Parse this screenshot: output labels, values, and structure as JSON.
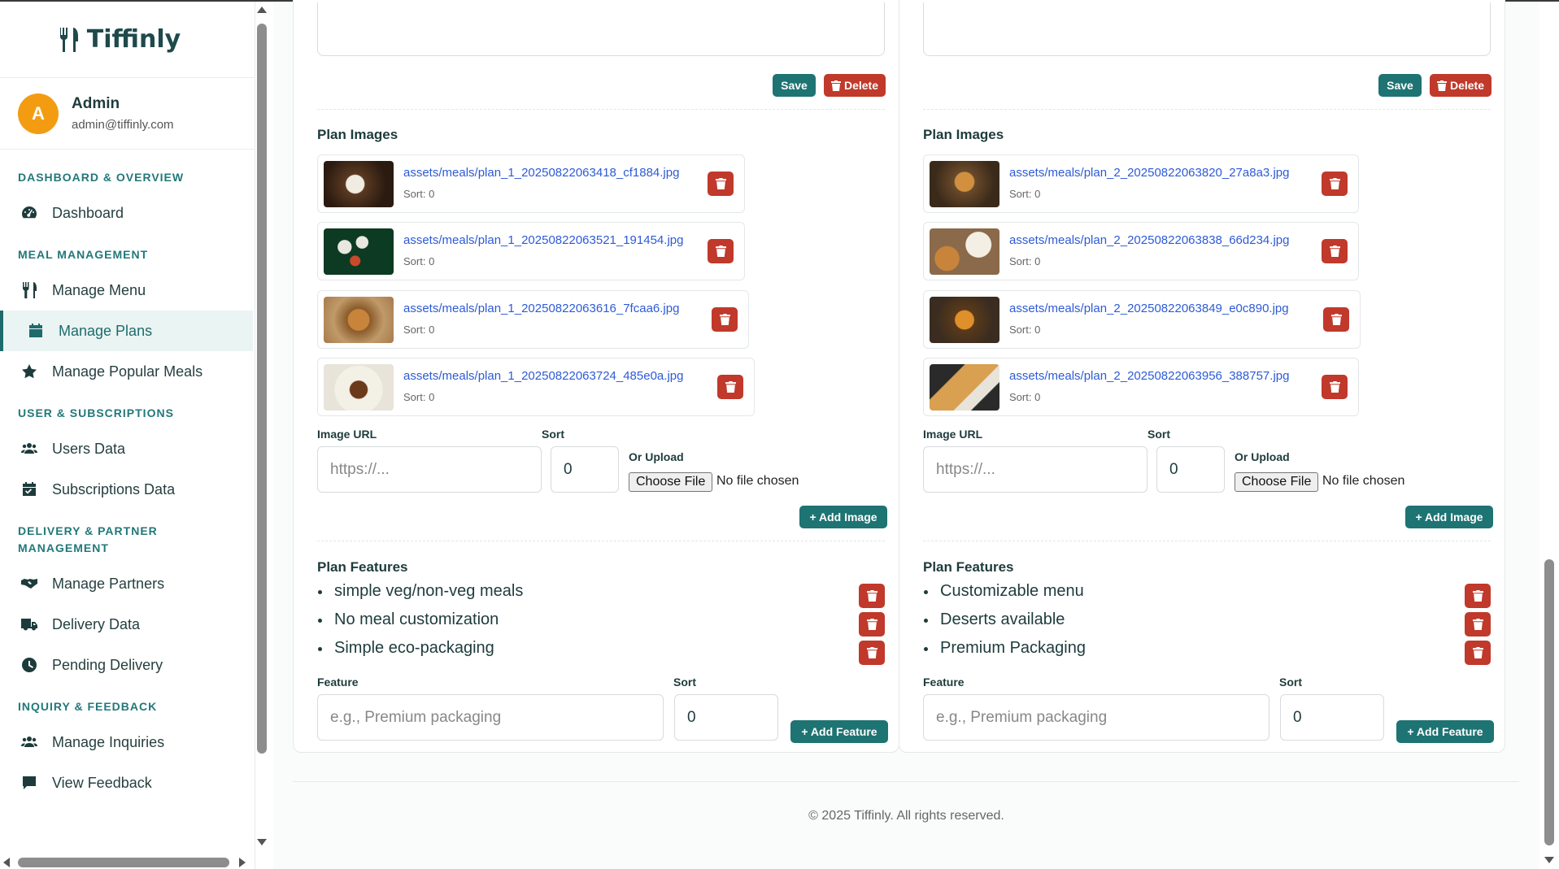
{
  "brand": {
    "name": "Tiffinly"
  },
  "user": {
    "initial": "A",
    "name": "Admin",
    "email": "admin@tiffinly.com"
  },
  "nav": {
    "sec_dashboard": "DASHBOARD & OVERVIEW",
    "dashboard": "Dashboard",
    "sec_meal": "MEAL MANAGEMENT",
    "manage_menu": "Manage Menu",
    "manage_plans": "Manage Plans",
    "manage_popular": "Manage Popular Meals",
    "sec_user": "USER & SUBSCRIPTIONS",
    "users_data": "Users Data",
    "subscriptions_data": "Subscriptions Data",
    "sec_delivery_1": "DELIVERY & PARTNER",
    "sec_delivery_2": "MANAGEMENT",
    "manage_partners": "Manage Partners",
    "delivery_data": "Delivery Data",
    "pending_delivery": "Pending Delivery",
    "sec_inquiry": "INQUIRY & FEEDBACK",
    "manage_inquiries": "Manage Inquiries",
    "view_feedback": "View Feedback"
  },
  "common": {
    "save": "Save",
    "delete": "Delete",
    "plan_images": "Plan Images",
    "image_url": "Image URL",
    "sort": "Sort",
    "or_upload": "Or Upload",
    "choose_file": "Choose File",
    "no_file": "No file chosen",
    "add_image": "+ Add Image",
    "plan_features": "Plan Features",
    "feature": "Feature",
    "add_feature": "+ Add Feature",
    "url_placeholder": "https://...",
    "feature_placeholder": "e.g., Premium packaging",
    "sort_value": "0"
  },
  "plan1": {
    "images": [
      {
        "path": "assets/meals/plan_1_20250822063418_cf1884.jpg",
        "sort": "Sort: 0"
      },
      {
        "path": "assets/meals/plan_1_20250822063521_191454.jpg",
        "sort": "Sort: 0"
      },
      {
        "path": "assets/meals/plan_1_20250822063616_7fcaa6.jpg",
        "sort": "Sort: 0"
      },
      {
        "path": "assets/meals/plan_1_20250822063724_485e0a.jpg",
        "sort": "Sort: 0"
      }
    ],
    "features": [
      "simple veg/non-veg meals",
      "No meal customization",
      "Simple eco-packaging"
    ]
  },
  "plan2": {
    "images": [
      {
        "path": "assets/meals/plan_2_20250822063820_27a8a3.jpg",
        "sort": "Sort: 0"
      },
      {
        "path": "assets/meals/plan_2_20250822063838_66d234.jpg",
        "sort": "Sort: 0"
      },
      {
        "path": "assets/meals/plan_2_20250822063849_e0c890.jpg",
        "sort": "Sort: 0"
      },
      {
        "path": "assets/meals/plan_2_20250822063956_388757.jpg",
        "sort": "Sort: 0"
      }
    ],
    "features": [
      "Customizable menu",
      "Deserts available",
      "Premium Packaging"
    ]
  },
  "footer": {
    "text": "© 2025 Tiffinly. All rights reserved."
  },
  "colors": {
    "primary": "#1e7373",
    "danger": "#c0392b",
    "accent": "#f39c12",
    "link": "#2d5bd7"
  }
}
